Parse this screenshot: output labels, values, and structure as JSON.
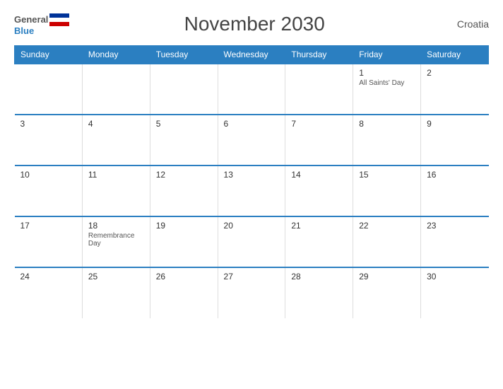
{
  "header": {
    "logo_general": "General",
    "logo_blue": "Blue",
    "title": "November 2030",
    "country": "Croatia"
  },
  "weekdays": [
    "Sunday",
    "Monday",
    "Tuesday",
    "Wednesday",
    "Thursday",
    "Friday",
    "Saturday"
  ],
  "weeks": [
    [
      {
        "day": "",
        "holiday": ""
      },
      {
        "day": "",
        "holiday": ""
      },
      {
        "day": "",
        "holiday": ""
      },
      {
        "day": "",
        "holiday": ""
      },
      {
        "day": "",
        "holiday": ""
      },
      {
        "day": "1",
        "holiday": "All Saints' Day"
      },
      {
        "day": "2",
        "holiday": ""
      }
    ],
    [
      {
        "day": "3",
        "holiday": ""
      },
      {
        "day": "4",
        "holiday": ""
      },
      {
        "day": "5",
        "holiday": ""
      },
      {
        "day": "6",
        "holiday": ""
      },
      {
        "day": "7",
        "holiday": ""
      },
      {
        "day": "8",
        "holiday": ""
      },
      {
        "day": "9",
        "holiday": ""
      }
    ],
    [
      {
        "day": "10",
        "holiday": ""
      },
      {
        "day": "11",
        "holiday": ""
      },
      {
        "day": "12",
        "holiday": ""
      },
      {
        "day": "13",
        "holiday": ""
      },
      {
        "day": "14",
        "holiday": ""
      },
      {
        "day": "15",
        "holiday": ""
      },
      {
        "day": "16",
        "holiday": ""
      }
    ],
    [
      {
        "day": "17",
        "holiday": ""
      },
      {
        "day": "18",
        "holiday": "Remembrance Day"
      },
      {
        "day": "19",
        "holiday": ""
      },
      {
        "day": "20",
        "holiday": ""
      },
      {
        "day": "21",
        "holiday": ""
      },
      {
        "day": "22",
        "holiday": ""
      },
      {
        "day": "23",
        "holiday": ""
      }
    ],
    [
      {
        "day": "24",
        "holiday": ""
      },
      {
        "day": "25",
        "holiday": ""
      },
      {
        "day": "26",
        "holiday": ""
      },
      {
        "day": "27",
        "holiday": ""
      },
      {
        "day": "28",
        "holiday": ""
      },
      {
        "day": "29",
        "holiday": ""
      },
      {
        "day": "30",
        "holiday": ""
      }
    ]
  ]
}
